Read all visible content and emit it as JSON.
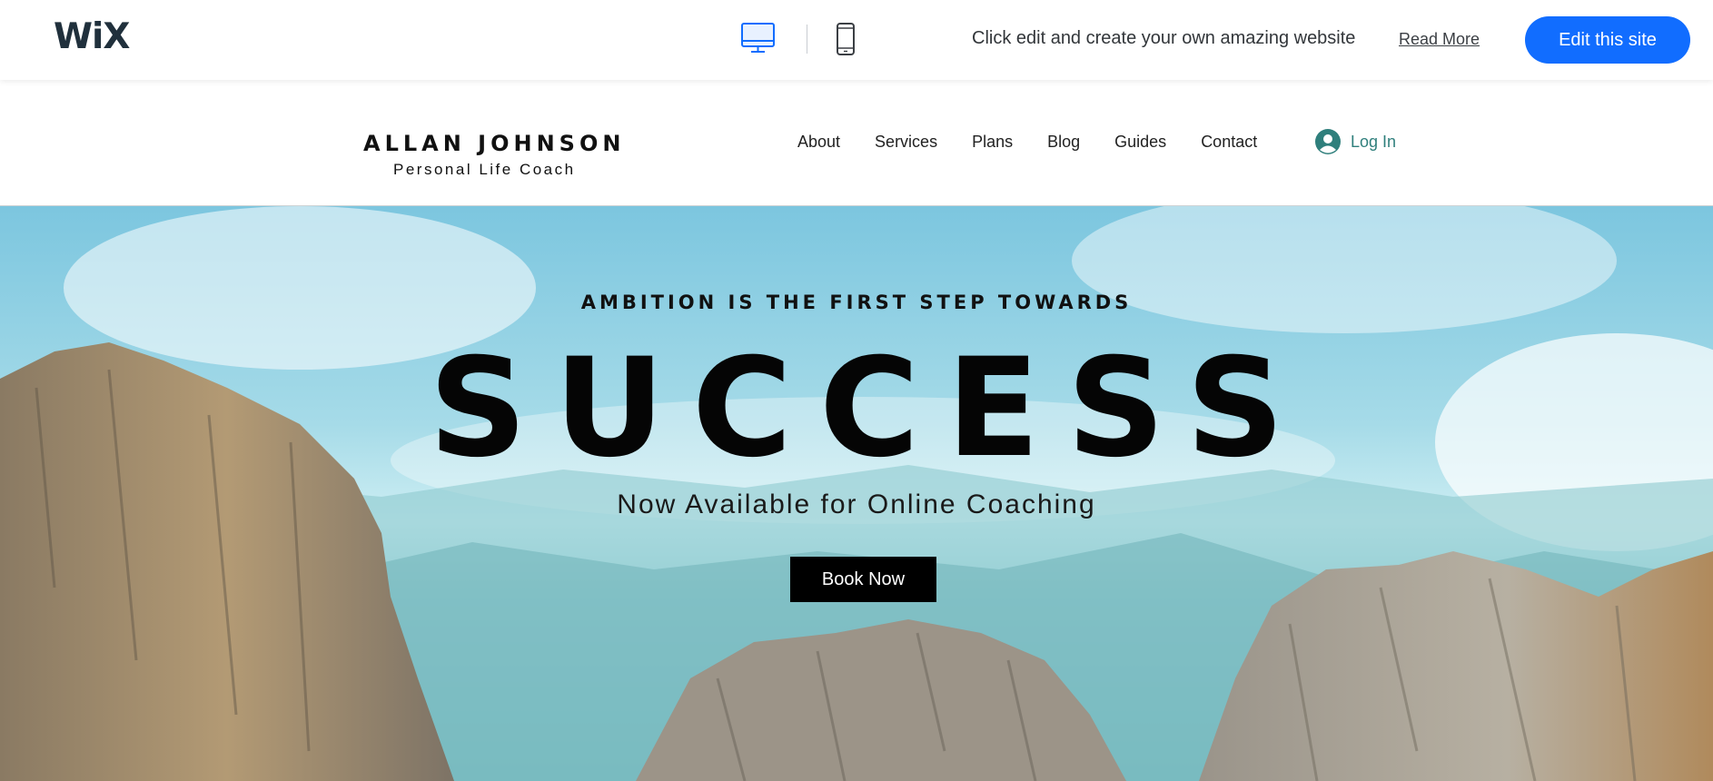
{
  "editor_bar": {
    "logo": "WiX",
    "promo_text": "Click edit and create your own amazing website",
    "read_more_label": "Read More",
    "edit_button_label": "Edit this site",
    "active_device": "desktop",
    "accent_color": "#116dff"
  },
  "site_header": {
    "brand_name": "ALLAN JOHNSON",
    "brand_tagline": "Personal Life Coach",
    "nav": [
      "About",
      "Services",
      "Plans",
      "Blog",
      "Guides",
      "Contact"
    ],
    "login_label": "Log In",
    "login_color": "#2f7f7c"
  },
  "hero": {
    "kicker": "AMBITION IS THE FIRST STEP TOWARDS",
    "title": "SUCCESS",
    "subtitle": "Now Available for Online Coaching",
    "cta_label": "Book Now"
  }
}
